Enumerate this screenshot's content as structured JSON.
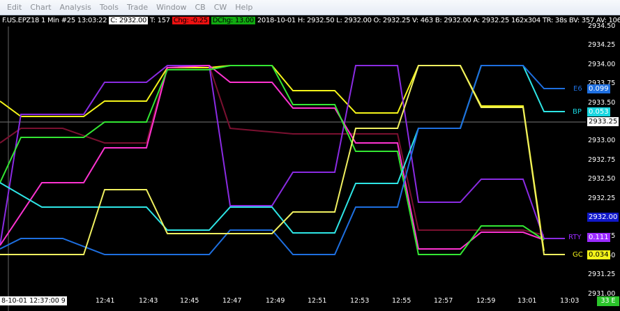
{
  "menu": [
    "Edit",
    "Chart",
    "Analysis",
    "Tools",
    "Trade",
    "Window",
    "CB",
    "CW",
    "Help"
  ],
  "header": {
    "symbol": "F.US.EPZ18",
    "interval": "1 Min",
    "bar": "#25 13:03:22",
    "close": "C: 2932.00",
    "ticks": "T: 157",
    "chg": "Chg: -0.25",
    "dchg": "DChg: 13.00",
    "date": "2018-10-01",
    "high": "H: 2932.50",
    "low": "L: 2932.00",
    "open": "O: 2932.25",
    "vol": "V: 463",
    "bid": "B: 2932.00",
    "ask": "A: 2932.25",
    "size": "162x304",
    "tr": "TR: 38s",
    "bv": "BV: 357",
    "av": "AV: 106 [",
    "start_time": "8-10-01 12:37:00 9"
  },
  "price_axis": [
    "2934.50",
    "2934.25",
    "2934.00",
    "2933.75",
    "2933.50",
    "2933.25",
    "2933.00",
    "2932.75",
    "2932.50",
    "2932.25",
    "2932.00",
    "2931.75",
    "2931.50",
    "2931.25",
    "2931.00"
  ],
  "current_price": "2933.25",
  "last_price_box": "2932.00",
  "time_axis": [
    "12:41",
    "12:43",
    "12:45",
    "12:47",
    "12:49",
    "12:51",
    "12:53",
    "12:55",
    "12:57",
    "12:59",
    "13:01",
    "13:03"
  ],
  "series_labels": [
    {
      "name": "E6",
      "value": "0.099",
      "color": "#1e6fe0"
    },
    {
      "name": "BP",
      "value": "0.053",
      "color": "#18d6e0"
    },
    {
      "name": "RTY",
      "value": "0.111",
      "color": "#9b2bff"
    },
    {
      "name": "GC",
      "value": "0.034",
      "color": "#f4f41a"
    }
  ],
  "corner_badge": "33 E",
  "colors": {
    "yellow": "#f4f41a",
    "cyan": "#2ee6e6",
    "blue": "#1e6fe0",
    "purple": "#8a2be2",
    "magenta": "#ff33d1",
    "green": "#33e633",
    "maroon": "#7a1030",
    "lightyellow": "#f0f060"
  }
}
